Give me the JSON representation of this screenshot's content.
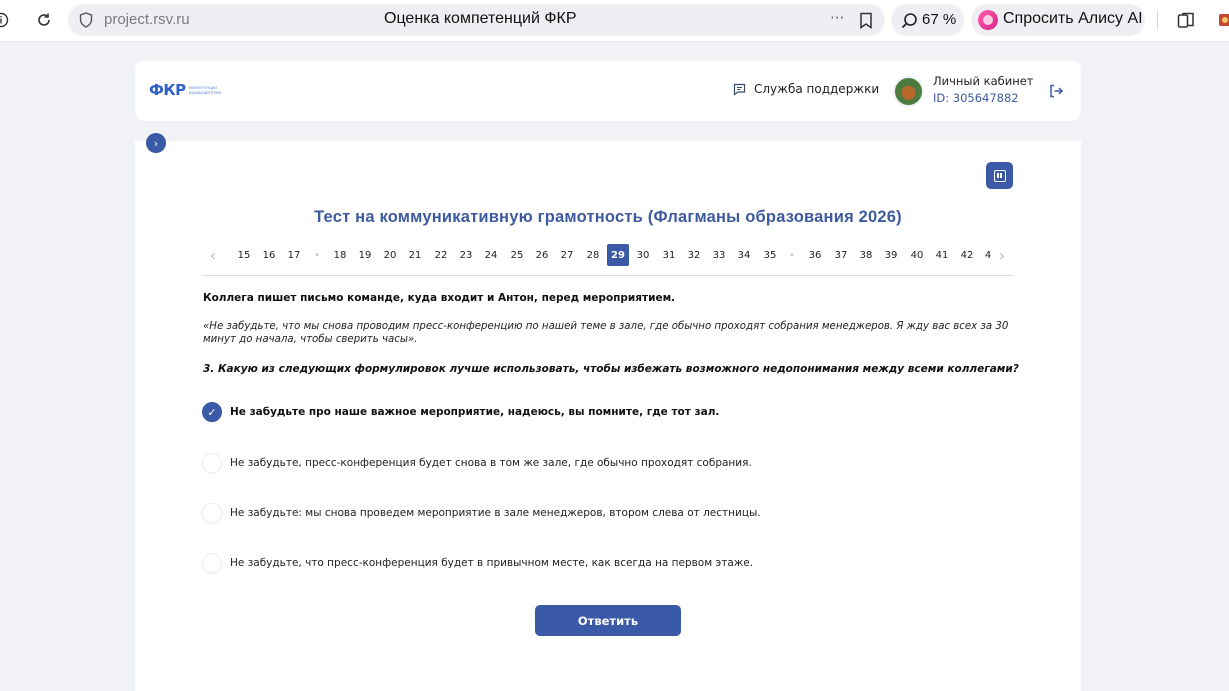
{
  "browser": {
    "url": "project.rsv.ru",
    "tab_title": "Оценка компетенций ФКР",
    "zoom": "67 %",
    "alice_label": "Спросить Алису AI",
    "more_dots": "···"
  },
  "header": {
    "logo_text": "ФКР",
    "logo_subtext": "компетенции руководителей",
    "support_label": "Служба поддержки",
    "cabinet_title": "Личный кабинет",
    "cabinet_id": "ID: 305647882"
  },
  "test": {
    "title": "Тест на коммуникативную грамотность (Флагманы образования 2026)",
    "pagination": [
      {
        "label": "‹",
        "kind": "arrow"
      },
      {
        "label": "15"
      },
      {
        "label": "16"
      },
      {
        "label": "17"
      },
      {
        "label": "•",
        "kind": "dot"
      },
      {
        "label": "18"
      },
      {
        "label": "19"
      },
      {
        "label": "20"
      },
      {
        "label": "21"
      },
      {
        "label": "22"
      },
      {
        "label": "23"
      },
      {
        "label": "24"
      },
      {
        "label": "25"
      },
      {
        "label": "26"
      },
      {
        "label": "27"
      },
      {
        "label": "28"
      },
      {
        "label": "29",
        "active": true
      },
      {
        "label": "30"
      },
      {
        "label": "31"
      },
      {
        "label": "32"
      },
      {
        "label": "33"
      },
      {
        "label": "34"
      },
      {
        "label": "35"
      },
      {
        "label": "•",
        "kind": "dot"
      },
      {
        "label": "36"
      },
      {
        "label": "37"
      },
      {
        "label": "38"
      },
      {
        "label": "39"
      },
      {
        "label": "40"
      },
      {
        "label": "41"
      },
      {
        "label": "42"
      },
      {
        "label": "4"
      },
      {
        "label": "›",
        "kind": "arrow"
      }
    ],
    "intro": "Коллега пишет письмо команде, куда входит и Антон, перед мероприятием.",
    "quote": "«Не забудьте, что мы снова проводим пресс-конференцию по нашей теме в зале, где обычно проходят собрания менеджеров. Я жду вас всех за 30 минут до начала, чтобы сверить часы».",
    "question": "3. Какую из следующих формулировок лучше использовать, чтобы избежать возможного недопонимания между всеми коллегами?",
    "options": [
      {
        "label": "Не забудьте про наше важное мероприятие, надеюсь, вы помните, где тот зал.",
        "selected": true
      },
      {
        "label": "Не забудьте, пресс-конференция будет снова в том же зале, где обычно проходят собрания.",
        "selected": false
      },
      {
        "label": "Не забудьте: мы снова проведем мероприятие в зале менеджеров, втором слева от лестницы.",
        "selected": false
      },
      {
        "label": "Не забудьте, что пресс-конференция будет в привычном месте, как всегда на первом этаже.",
        "selected": false
      }
    ],
    "submit_label": "Ответить"
  },
  "colors": {
    "accent": "#3a59a6",
    "title": "#3e5b9f",
    "page_bg": "#f1f2f6"
  }
}
